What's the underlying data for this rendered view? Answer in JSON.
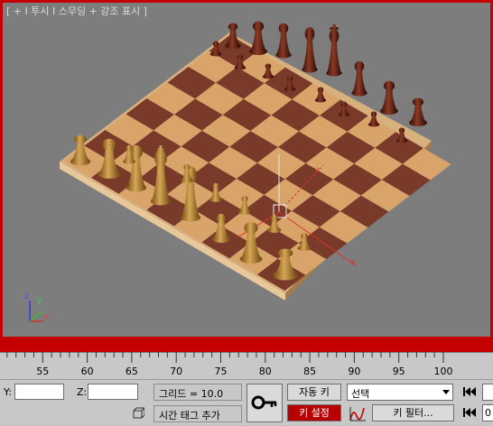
{
  "viewport": {
    "label": "[ + I 투시 I 스무딩 + 강조 표시 ]",
    "axis_x": "x",
    "axis_y": "y",
    "axis_z": "z",
    "gizmo_x": "x",
    "gizmo_y": "y"
  },
  "timeline": {
    "start": 50,
    "end": 100,
    "labels": [
      "55",
      "60",
      "65",
      "70",
      "75",
      "80",
      "85",
      "90",
      "95",
      "100"
    ]
  },
  "status": {
    "y_label": "Y:",
    "y_value": "",
    "z_label": "Z:",
    "z_value": "",
    "grid_text": "그리드 = 10.0",
    "time_tag_text": "시간 태그 추가"
  },
  "keys": {
    "auto_key": "자동 키",
    "set_key": "키 설정",
    "selection_value": "선택",
    "key_filter": "키 필터...",
    "frame_value": "0"
  },
  "colors": {
    "viewport_bg": "#7d7d7d",
    "active_border": "#c40000",
    "light_square": "#d9a46a",
    "dark_square": "#7a3a2a",
    "light_piece": "#b58535",
    "dark_piece": "#5a1f12"
  }
}
